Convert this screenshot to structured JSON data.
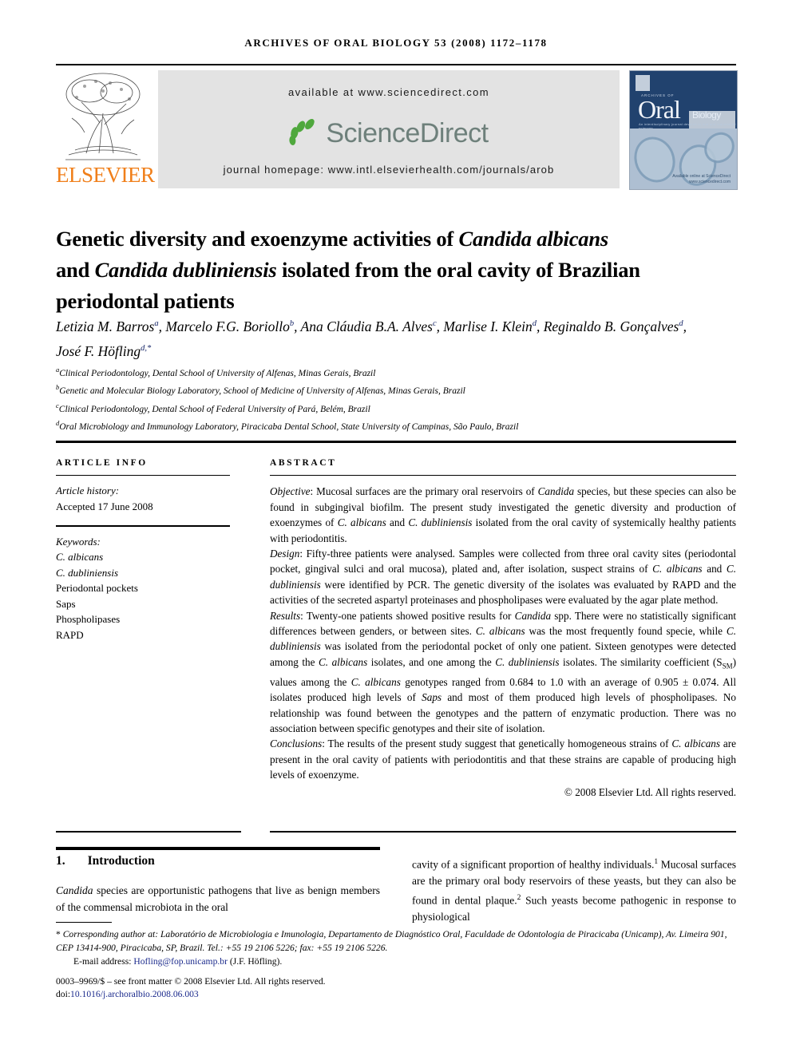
{
  "running_head": "ARCHIVES OF ORAL BIOLOGY 53 (2008) 1172–1178",
  "masthead": {
    "publisher": "ELSEVIER",
    "available_at": "available at www.sciencedirect.com",
    "sciencedirect_wordmark": "ScienceDirect",
    "journal_homepage": "journal homepage: www.intl.elsevierhealth.com/journals/arob",
    "cover": {
      "archives_of": "ARCHIVES OF",
      "oral": "Oral",
      "biology": "Biology",
      "tagline": "An interdisciplinary journal devoted to oral and craniofacial sciences",
      "available_online": "Available online at\nScienceDirect\nwww.sciencedirect.com"
    },
    "colors": {
      "elsevier_orange": "#f07f1a",
      "sciencedirect_green": "#4fa83d",
      "sciencedirect_grey": "#6e807b",
      "banner_grey": "#e3e3e3",
      "cover_blue": "#21426e",
      "link_blue": "#1b2a8c"
    }
  },
  "article": {
    "title_parts": [
      {
        "t": "Genetic diversity and exoenzyme activities of ",
        "i": false
      },
      {
        "t": "Candida albicans",
        "i": true
      },
      {
        "t": " and ",
        "i": false
      },
      {
        "t": "Candida dubliniensis",
        "i": true
      },
      {
        "t": " isolated from the oral cavity of Brazilian periodontal patients",
        "i": false
      }
    ],
    "title_plain": "Genetic diversity and exoenzyme activities of Candida albicans and Candida dubliniensis isolated from the oral cavity of Brazilian periodontal patients",
    "authors": [
      {
        "name": "Letizia M. Barros",
        "sup": "a"
      },
      {
        "name": "Marcelo F.G. Boriollo",
        "sup": "b"
      },
      {
        "name": "Ana Cláudia B.A. Alves",
        "sup": "c"
      },
      {
        "name": "Marlise I. Klein",
        "sup": "d"
      },
      {
        "name": "Reginaldo B. Gonçalves",
        "sup": "d"
      },
      {
        "name": "José F. Höfling",
        "sup": "d,*"
      }
    ],
    "affiliations": [
      {
        "mark": "a",
        "text": "Clinical Periodontology, Dental School of University of Alfenas, Minas Gerais, Brazil"
      },
      {
        "mark": "b",
        "text": "Genetic and Molecular Biology Laboratory, School of Medicine of University of Alfenas, Minas Gerais, Brazil"
      },
      {
        "mark": "c",
        "text": "Clinical Periodontology, Dental School of Federal University of Pará, Belém, Brazil"
      },
      {
        "mark": "d",
        "text": "Oral Microbiology and Immunology Laboratory, Piracicaba Dental School, State University of Campinas, São Paulo, Brazil"
      }
    ]
  },
  "article_info": {
    "heading": "ARTICLE INFO",
    "history_label": "Article history:",
    "history_value": "Accepted 17 June 2008",
    "keywords_label": "Keywords:",
    "keywords": [
      "C. albicans",
      "C. dubliniensis",
      "Periodontal pockets",
      "Saps",
      "Phospholipases",
      "RAPD"
    ]
  },
  "abstract": {
    "heading": "ABSTRACT",
    "objective_label": "Objective",
    "objective_text": ": Mucosal surfaces are the primary oral reservoirs of Candida species, but these species can also be found in subgingival biofilm. The present study investigated the genetic diversity and production of exoenzymes of C. albicans and C. dubliniensis isolated from the oral cavity of systemically healthy patients with periodontitis.",
    "design_label": "Design",
    "design_text": ": Fifty-three patients were analysed. Samples were collected from three oral cavity sites (periodontal pocket, gingival sulci and oral mucosa), plated and, after isolation, suspect strains of C. albicans and C. dubliniensis were identified by PCR. The genetic diversity of the isolates was evaluated by RAPD and the activities of the secreted aspartyl proteinases and phospholipases were evaluated by the agar plate method.",
    "results_label": "Results",
    "results_text": ": Twenty-one patients showed positive results for Candida spp. There were no statistically significant differences between genders, or between sites. C. albicans was the most frequently found specie, while C. dubliniensis was isolated from the periodontal pocket of only one patient. Sixteen genotypes were detected among the C. albicans isolates, and one among the C. dubliniensis isolates. The similarity coefficient (SSM) values among the C. albicans genotypes ranged from 0.684 to 1.0 with an average of 0.905 ± 0.074. All isolates produced high levels of Saps and most of them produced high levels of phospholipases. No relationship was found between the genotypes and the pattern of enzymatic production. There was no association between specific genotypes and their site of isolation.",
    "conclusions_label": "Conclusions",
    "conclusions_text": ": The results of the present study suggest that genetically homogeneous strains of C. albicans are present in the oral cavity of patients with periodontitis and that these strains are capable of producing high levels of exoenzyme.",
    "copyright": "© 2008 Elsevier Ltd. All rights reserved."
  },
  "introduction": {
    "number": "1.",
    "heading": "Introduction",
    "col_left": "Candida species are opportunistic pathogens that live as benign members of the commensal microbiota in the oral",
    "col_right": "cavity of a significant proportion of healthy individuals.1 Mucosal surfaces are the primary oral body reservoirs of these yeasts, but they can also be found in dental plaque.2 Such yeasts become pathogenic in response to physiological"
  },
  "footer": {
    "corresponding": "Corresponding author at: Laboratório de Microbiologia e Imunologia, Departamento de Diagnóstico Oral, Faculdade de Odontologia de Piracicaba (Unicamp), Av. Limeira 901, CEP 13414-900, Piracicaba, SP, Brazil. Tel.: +55 19 2106 5226; fax: +55 19 2106 5226.",
    "email_label": "E-mail address:",
    "email": "Hofling@fop.unicamp.br",
    "email_owner": "(J.F. Höfling).",
    "issn_line": "0003–9969/$ – see front matter © 2008 Elsevier Ltd. All rights reserved.",
    "doi_prefix": "doi:",
    "doi": "10.1016/j.archoralbio.2008.06.003"
  }
}
